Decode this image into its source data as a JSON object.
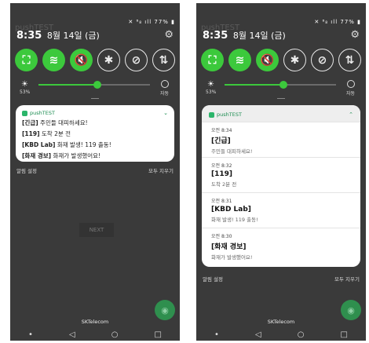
{
  "colors": {
    "accent_green": "#3cc93c",
    "panel_bg": "#2f2f2f",
    "app_name_green": "#1a8c50"
  },
  "screens": [
    {
      "app_ghost": "pushTEST",
      "status_icons": "✕ ⁸₈ ıll 77% ▮",
      "time": "8:35",
      "date": "8월 14일 (금)",
      "tiles": [
        {
          "icon": "screen-capture-icon",
          "glyph": "⛶",
          "on": true
        },
        {
          "icon": "wifi-icon",
          "glyph": "≋",
          "on": true
        },
        {
          "icon": "sound-mute-icon",
          "glyph": "🔇",
          "on": true
        },
        {
          "icon": "bluetooth-icon",
          "glyph": "✱",
          "on": false
        },
        {
          "icon": "rotation-lock-icon",
          "glyph": "⊘",
          "on": false
        },
        {
          "icon": "data-transfer-icon",
          "glyph": "⇅",
          "on": false
        }
      ],
      "brightness_pct_label": "53%",
      "brightness_level": 0.53,
      "auto_label": "자동",
      "notification": {
        "app_name": "pushTEST",
        "lines": [
          {
            "tag": "[긴급]",
            "text": " 주민들 대피하세요!"
          },
          {
            "tag": "[119]",
            "text": " 도착 2분 전"
          },
          {
            "tag": "[KBD Lab]",
            "text": " 화재 발생! 119 출동!"
          },
          {
            "tag": "[화재 경보]",
            "text": " 화재가 발생했어요!"
          }
        ]
      },
      "actions": {
        "settings": "알림 설정",
        "clear": "모두 지우기"
      },
      "next_button": "NEXT",
      "carrier": "SKTelecom",
      "nav": {
        "dot": "•",
        "back": "◁",
        "home": "○",
        "recent": "□"
      }
    },
    {
      "app_ghost": "pushTEST",
      "status_icons": "✕ ⁸₈ ıll 77% ▮",
      "time": "8:35",
      "date": "8월 14일 (금)",
      "brightness_pct_label": "53%",
      "brightness_level": 0.53,
      "auto_label": "자동",
      "notification": {
        "app_name": "pushTEST",
        "items": [
          {
            "time": "오전 8:34",
            "title": "[긴급]",
            "body": "주민들 대피하세요!"
          },
          {
            "time": "오전 8:32",
            "title": "[119]",
            "body": "도착 2분 전"
          },
          {
            "time": "오전 8:31",
            "title": "[KBD Lab]",
            "body": "화재 발생! 119 출동!"
          },
          {
            "time": "오전 8:30",
            "title": "[화재 경보]",
            "body": "화재가 발생했어요!"
          }
        ]
      },
      "actions": {
        "settings": "알림 설정",
        "clear": "모두 지우기"
      },
      "carrier": "SKTelecom",
      "nav": {
        "dot": "•",
        "back": "◁",
        "home": "○",
        "recent": "□"
      }
    }
  ]
}
